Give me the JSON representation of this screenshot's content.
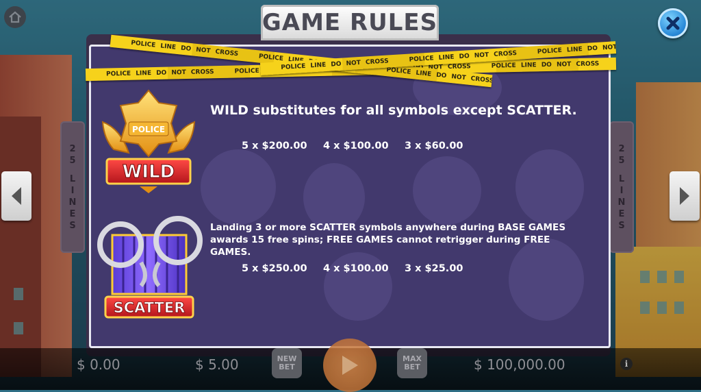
{
  "title": "GAME RULES",
  "side_lines": {
    "left": [
      "2",
      "5",
      "L",
      "I",
      "N",
      "E",
      "S"
    ],
    "right": [
      "2",
      "5",
      "L",
      "I",
      "N",
      "E",
      "S"
    ]
  },
  "tape_text": "POLICE LINE DO NOT CROSS",
  "wild": {
    "badge_top": "POLICE",
    "badge_label": "WILD",
    "description": "WILD substitutes for all symbols except SCATTER.",
    "payouts": [
      "5 x $200.00",
      "4 x $100.00",
      "3 x $60.00"
    ]
  },
  "scatter": {
    "badge_label": "SCATTER",
    "description": "Landing 3 or more SCATTER symbols anywhere during BASE GAMES awards 15 free spins; FREE GAMES cannot retrigger during FREE GAMES.",
    "payouts": [
      "5 x $250.00",
      "4 x $100.00",
      "3 x $25.00"
    ]
  },
  "bottom": {
    "balance": "$ 0.00",
    "bet": "$ 5.00",
    "new_bet_line1": "NEW",
    "new_bet_line2": "BET",
    "max_bet_line1": "MAX",
    "max_bet_line2": "BET",
    "win": "$ 100,000.00",
    "info": "i"
  },
  "icons": [
    "home-icon",
    "close-icon",
    "arrow-left-icon",
    "arrow-right-icon",
    "play-icon",
    "info-icon"
  ],
  "colors": {
    "panel": "#433a70",
    "title_text": "#4a4a55",
    "tape": "#f6d21b",
    "close": "#2a8ad8",
    "wild_red": "#d8262b"
  }
}
